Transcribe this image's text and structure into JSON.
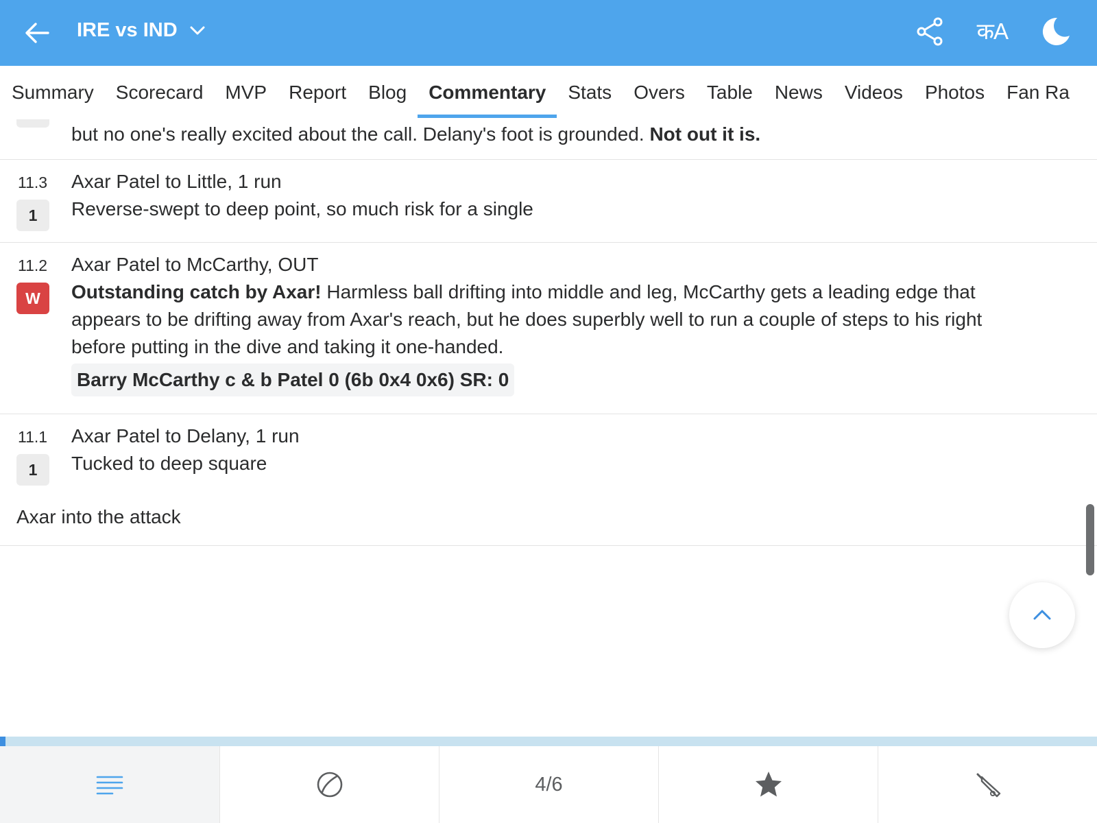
{
  "header": {
    "title": "IRE vs IND",
    "lang_label": "कA",
    "colors": {
      "bar": "#4ea5ec",
      "active_tab_underline": "#4ea5ec",
      "wicket_badge": "#d94343"
    }
  },
  "tabs": [
    {
      "label": "Summary"
    },
    {
      "label": "Scorecard"
    },
    {
      "label": "MVP"
    },
    {
      "label": "Report"
    },
    {
      "label": "Blog"
    },
    {
      "label": "Commentary",
      "active": true
    },
    {
      "label": "Stats"
    },
    {
      "label": "Overs"
    },
    {
      "label": "Table"
    },
    {
      "label": "News"
    },
    {
      "label": "Videos"
    },
    {
      "label": "Photos"
    },
    {
      "label": "Fan Ra"
    }
  ],
  "commentary": {
    "partial": {
      "text_plain": "but no one's really excited about the call. Delany's foot is grounded. ",
      "text_bold": "Not out it is."
    },
    "balls": [
      {
        "over": "11.3",
        "badge": "1",
        "title": "Axar Patel to Little, 1 run",
        "text": "Reverse-swept to deep point, so much risk for a single"
      },
      {
        "over": "11.2",
        "badge": "W",
        "title": "Axar Patel to McCarthy, OUT",
        "text_bold": "Outstanding catch by Axar!",
        "text": " Harmless ball drifting into middle and leg, McCarthy gets a leading edge that appears to be drifting away from Axar's reach, but he does superbly well to run a couple of steps to his right before putting in the dive and taking it one-handed.",
        "dismissal": "Barry McCarthy c & b Patel 0 (6b 0x4 0x6) SR: 0"
      },
      {
        "over": "11.1",
        "badge": "1",
        "title": "Axar Patel to Delany, 1 run",
        "text": "Tucked to deep square"
      }
    ],
    "note": "Axar into the attack"
  },
  "progress": {
    "fraction": 0.005
  },
  "bottom_nav": {
    "items": [
      {
        "icon": "menu-lines-icon"
      },
      {
        "icon": "cricket-ball-icon"
      },
      {
        "label": "4/6"
      },
      {
        "icon": "star-icon"
      },
      {
        "icon": "cricket-bat-icon"
      }
    ],
    "page_label": "4/6"
  }
}
